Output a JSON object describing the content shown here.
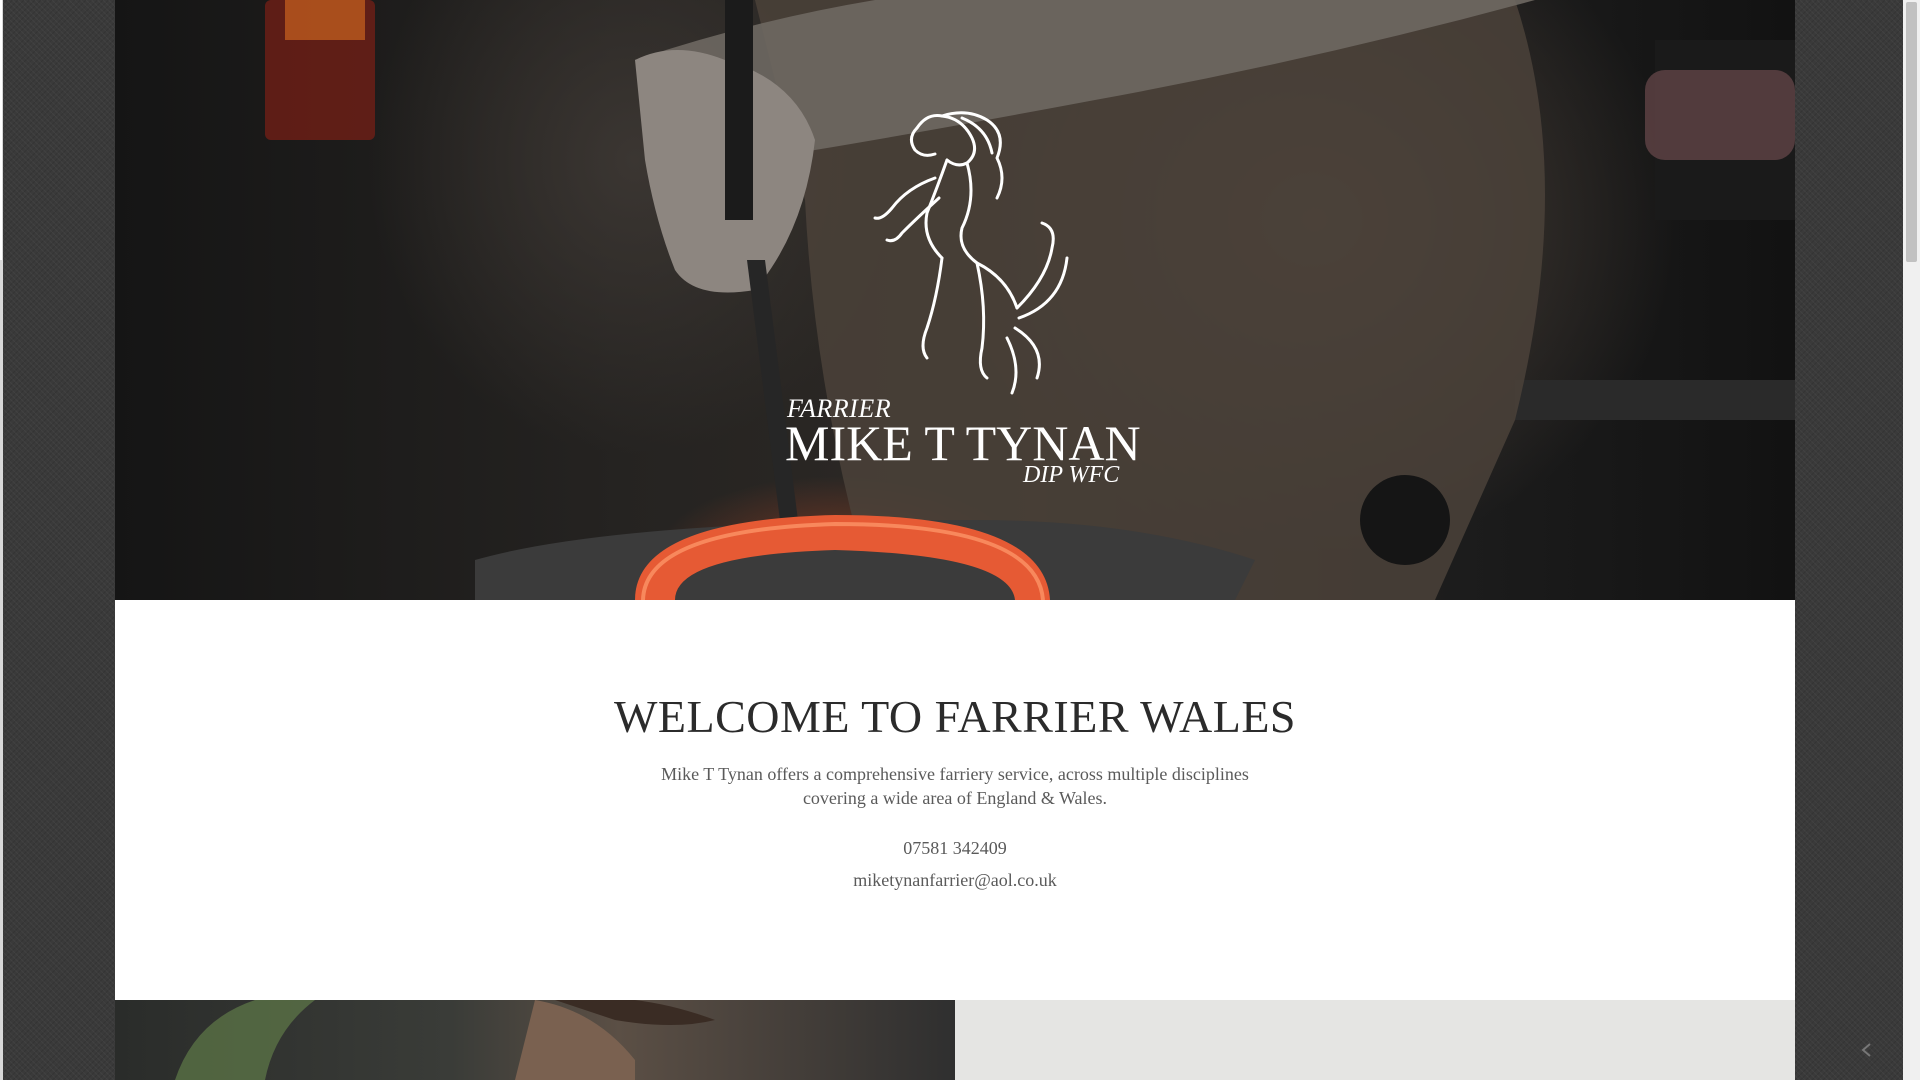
{
  "hero": {
    "logo_icon": "rearing-horse-icon",
    "logo_top": "FARRIER",
    "logo_name": "MIKE T TYNAN",
    "logo_suffix": "DIP WFC"
  },
  "welcome": {
    "title": "WELCOME TO FARRIER WALES",
    "description": "Mike T Tynan offers a comprehensive farriery service, across multiple disciplines covering a wide area of England & Wales.",
    "phone": "07581 342409",
    "email": "miketynanfarrier@aol.co.uk"
  },
  "colors": {
    "page_background": "#3a3a3a",
    "content_background": "#ffffff",
    "heading_text": "#2b2b2b",
    "body_text": "#5a5a5a",
    "panel_grey": "#e5e5e3"
  },
  "icons": {
    "scroll_arrow": "chevron-left-icon"
  }
}
